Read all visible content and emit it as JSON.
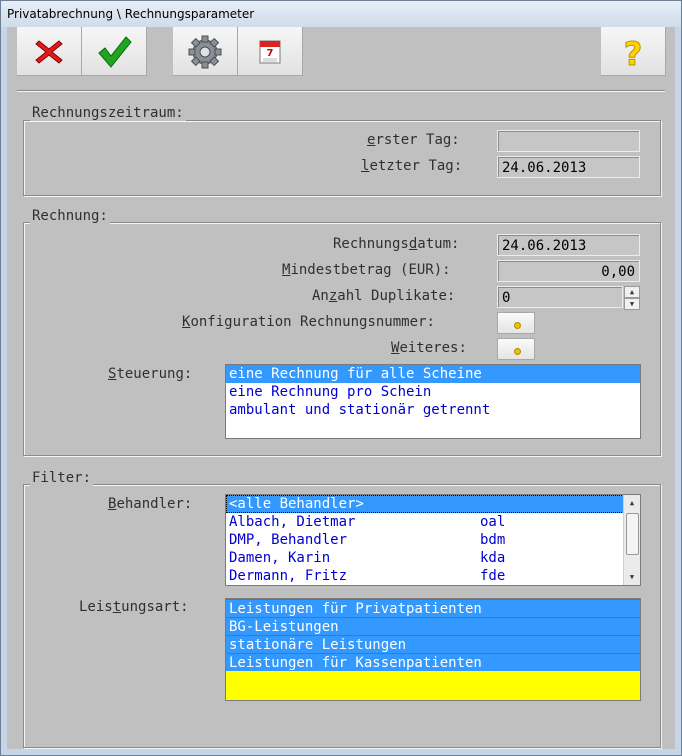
{
  "window": {
    "title": "Privatabrechnung \\ Rechnungsparameter"
  },
  "toolbar": {
    "cancel_icon": "red-x-icon",
    "ok_icon": "green-checkmark-icon",
    "settings_icon": "gear-icon",
    "calendar_icon": "calendar-icon",
    "help_icon": "yellow-question-mark-icon",
    "calendar_day": "7"
  },
  "period": {
    "legend": "Rechnungszeitraum:",
    "first_day_label_u": "e",
    "first_day_label_rest": "rster Tag:",
    "first_day_value": "",
    "last_day_label_u": "l",
    "last_day_label_rest": "etzter Tag:",
    "last_day_value": "24.06.2013"
  },
  "invoice": {
    "legend": "Rechnung:",
    "date_label_pre": "Rechnungs",
    "date_label_u": "d",
    "date_label_post": "atum:",
    "date_value": "24.06.2013",
    "min_label_u": "M",
    "min_label_rest": "indestbetrag (EUR):",
    "min_value": "0,00",
    "dup_label_pre": "An",
    "dup_label_u": "z",
    "dup_label_post": "ahl Duplikate:",
    "dup_value": "0",
    "config_label_u": "K",
    "config_label_rest": "onfiguration Rechnungsnummer:",
    "more_label_u": "W",
    "more_label_rest": "eiteres:",
    "control_label_u": "S",
    "control_label_rest": "teuerung:",
    "control_options": [
      "eine Rechnung für alle Scheine",
      "eine Rechnung pro Schein",
      "ambulant und stationär getrennt"
    ]
  },
  "filter": {
    "legend": "Filter:",
    "provider_label_u": "B",
    "provider_label_rest": "ehandler:",
    "providers": [
      {
        "name": "<alle Behandler>",
        "code": ""
      },
      {
        "name": "Albach, Dietmar",
        "code": "oal"
      },
      {
        "name": "DMP, Behandler",
        "code": "bdm"
      },
      {
        "name": "Damen, Karin",
        "code": "kda"
      },
      {
        "name": "Dermann, Fritz",
        "code": "fde"
      }
    ],
    "service_label_pre": "Leis",
    "service_label_u": "t",
    "service_label_post": "ungsart:",
    "services": [
      "Leistungen für Privatpatienten",
      "BG-Leistungen",
      "stationäre Leistungen",
      "Leistungen für Kassenpatienten"
    ],
    "highlight_color": "#ffff00",
    "selection_color": "#3399ff"
  }
}
